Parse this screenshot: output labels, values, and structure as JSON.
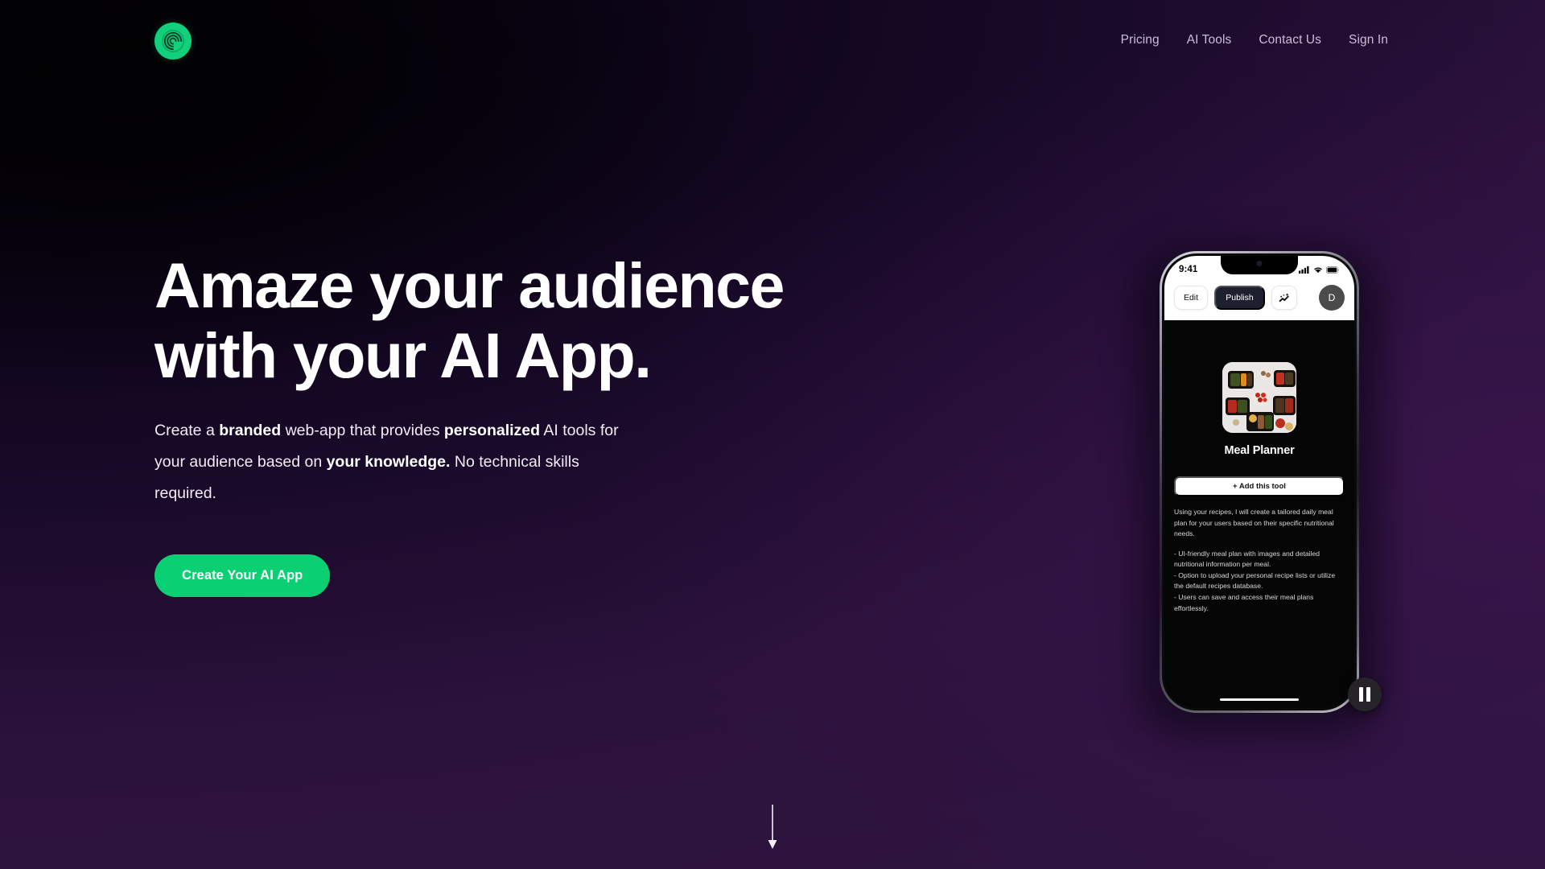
{
  "brand": {
    "logo_icon": "spiral-circle-logo-icon",
    "accent_green": "#0ACF73",
    "background_purple": "#2B123B",
    "background_black": "#060209"
  },
  "nav": {
    "items": [
      {
        "label": "Pricing"
      },
      {
        "label": "AI Tools"
      },
      {
        "label": "Contact Us"
      },
      {
        "label": "Sign In"
      }
    ]
  },
  "hero": {
    "headline": "Amaze your audience\nwith your AI App.",
    "subtitle": {
      "part1": "Create a ",
      "bold1": "branded",
      "part2": " web-app that provides ",
      "bold2": "personalized",
      "part3": " AI tools for your audience based on ",
      "bold3": "your knowledge.",
      "part4": " No technical skills required."
    },
    "cta_label": "Create Your AI App",
    "scroll_hint_icon": "down-arrow-icon"
  },
  "phone": {
    "status": {
      "time": "9:41",
      "signal_icon": "cellular-signal-icon",
      "wifi_icon": "wifi-icon",
      "battery_icon": "battery-icon"
    },
    "toolbar": {
      "edit_label": "Edit",
      "publish_label": "Publish",
      "magic_icon": "sparkle-chart-icon",
      "avatar_initial": "D"
    },
    "tool": {
      "image_alt": "meal-prep-containers-photo",
      "name": "Meal Planner",
      "add_button_label": "+  Add this tool",
      "description_intro": "Using your recipes, I will create a tailored daily meal plan for your users based on their specific nutritional needs.",
      "description_bullets": [
        "- UI-friendly meal plan with images and detailed nutritional information per meal.",
        "- Option to upload your personal recipe lists or utilize the default recipes database.",
        "- Users can save and access their meal plans effortlessly."
      ]
    },
    "pause_control_icon": "pause-icon"
  }
}
